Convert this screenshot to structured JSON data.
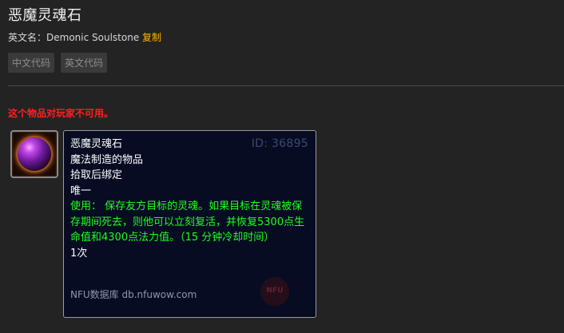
{
  "item": {
    "title": "恶魔灵魂石",
    "english_name_label": "英文名：",
    "english_name": "Demonic Soulstone",
    "copy_label": "复制"
  },
  "code_buttons": [
    "中文代码",
    "英文代码"
  ],
  "warning": "这个物品对玩家不可用。",
  "icon": {
    "name": "soulstone-orb-icon"
  },
  "tooltip": {
    "name": "恶魔灵魂石",
    "id_text": "ID: 36895",
    "lines": [
      "魔法制造的物品",
      "拾取后绑定",
      "唯一"
    ],
    "use_text": "使用： 保存友方目标的灵魂。如果目标在灵魂被保存期间死去，则他可以立刻复活，并恢复5300点生命值和4300点法力值。（15 分钟冷却时间）",
    "charges": "1次",
    "footer": "NFU数据库 db.nfuwow.com",
    "watermark": "NFU"
  },
  "colors": {
    "background": "#232323",
    "tooltip_bg": "#070c23",
    "use_green": "#1fff1f",
    "warning_red": "#ff2020",
    "copy_orange": "#ffb400"
  }
}
